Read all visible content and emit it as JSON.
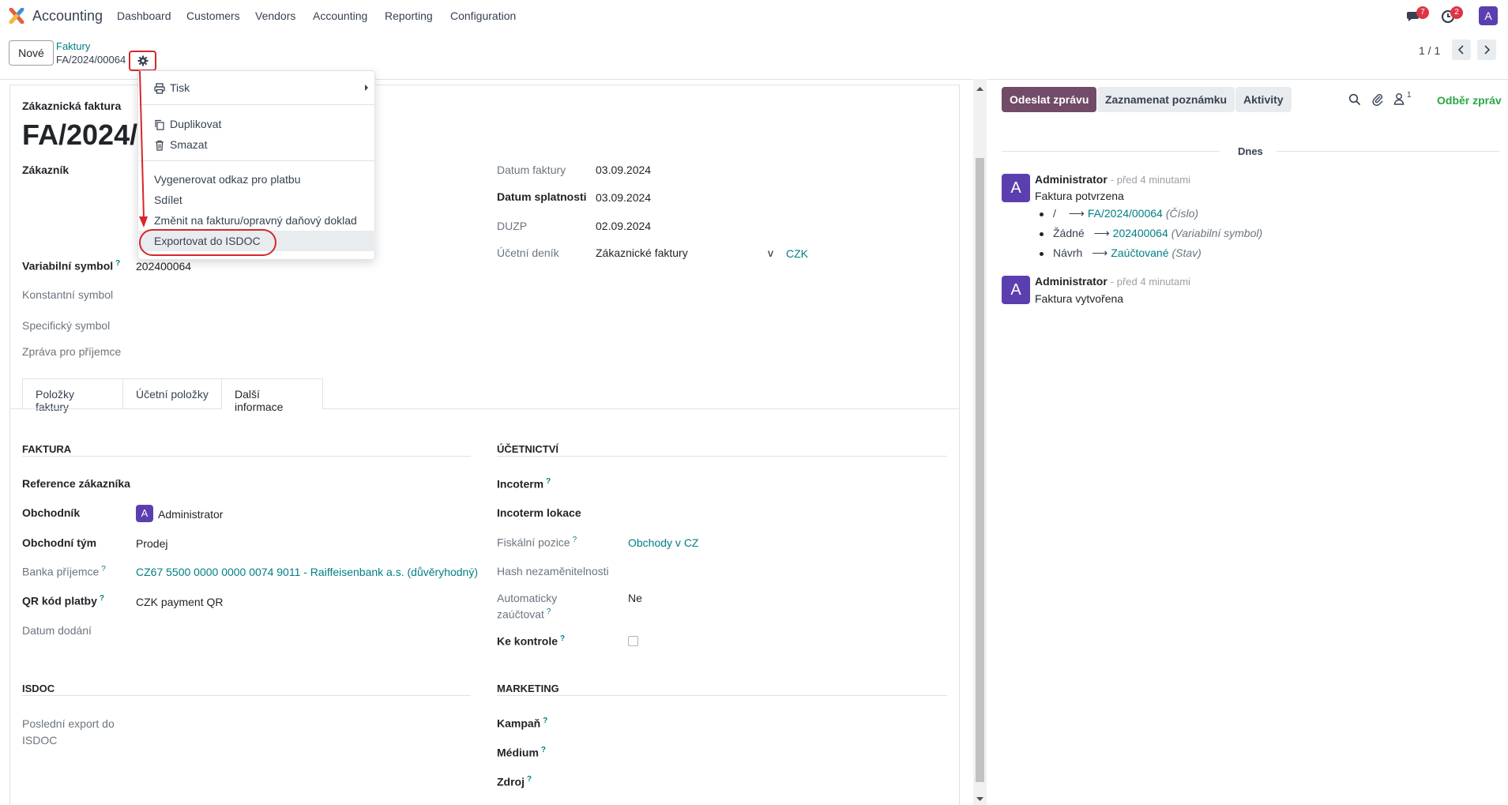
{
  "navbar": {
    "app_name": "Accounting",
    "menu": [
      "Dashboard",
      "Customers",
      "Vendors",
      "Accounting",
      "Reporting",
      "Configuration"
    ],
    "messages_badge": "7",
    "activities_badge": "2",
    "user_initial": "A"
  },
  "control": {
    "new_button": "Nové",
    "breadcrumb_parent": "Faktury",
    "breadcrumb_current": "FA/2024/00064",
    "pager": "1 / 1"
  },
  "dropdown": {
    "print": "Tisk",
    "duplicate": "Duplikovat",
    "delete": "Smazat",
    "gen_payment_link": "Vygenerovat odkaz pro platbu",
    "share": "Sdílet",
    "convert": "Změnit na fakturu/opravný daňový doklad",
    "export_isdoc": "Exportovat do ISDOC"
  },
  "form": {
    "doc_type": "Zákaznická faktura",
    "doc_number": "FA/2024/0",
    "customer_label": "Zákazník",
    "var_symbol_label": "Variabilní symbol",
    "var_symbol_value": "202400064",
    "const_symbol_label": "Konstantní symbol",
    "spec_symbol_label": "Specifický symbol",
    "recipient_msg_label": "Zpráva pro příjemce",
    "invoice_date_label": "Datum faktury",
    "invoice_date_value": "03.09.2024",
    "due_date_label": "Datum splatnosti",
    "due_date_value": "03.09.2024",
    "duzp_label": "DUZP",
    "duzp_value": "02.09.2024",
    "journal_label": "Účetní deník",
    "journal_value": "Zákaznické faktury",
    "journal_in": "v",
    "currency": "CZK"
  },
  "tabs": [
    "Položky faktury",
    "Účetní položky",
    "Další informace"
  ],
  "other_info": {
    "invoice_section": "FAKTURA",
    "customer_ref_label": "Reference zákazníka",
    "salesperson_label": "Obchodník",
    "salesperson_initial": "A",
    "salesperson_value": "Administrator",
    "sales_team_label": "Obchodní tým",
    "sales_team_value": "Prodej",
    "bank_label": "Banka příjemce",
    "bank_value": "CZ67 5500 0000 0000 0074 9011 - Raiffeisenbank a.s. (důvěryhodný)",
    "qr_label": "QR kód platby",
    "qr_value": "CZK payment QR",
    "delivery_date_label": "Datum dodání",
    "accounting_section": "ÚČETNICTVÍ",
    "incoterm_label": "Incoterm",
    "incoterm_location_label": "Incoterm lokace",
    "fiscal_position_label": "Fiskální pozice",
    "fiscal_position_value": "Obchody v CZ",
    "hash_label": "Hash nezaměnitelnosti",
    "auto_post_label_1": "Automaticky",
    "auto_post_label_2": "zaúčtovat",
    "auto_post_value": "Ne",
    "to_check_label": "Ke kontrole",
    "isdoc_section": "ISDOC",
    "last_export_label_1": "Poslední export do",
    "last_export_label_2": "ISDOC",
    "marketing_section": "MARKETING",
    "campaign_label": "Kampaň",
    "medium_label": "Médium",
    "source_label": "Zdroj",
    "help_mark": "?"
  },
  "chatter": {
    "send_message": "Odeslat zprávu",
    "log_note": "Zaznamenat poznámku",
    "activities": "Aktivity",
    "followers_count": "1",
    "follow": "Odběr zpráv",
    "day": "Dnes",
    "messages": [
      {
        "initial": "A",
        "author": "Administrator",
        "time": "- před 4 minutami",
        "body": "Faktura potvrzena",
        "tracking": [
          {
            "old": "/",
            "new": "FA/2024/00064",
            "field": "(Číslo)"
          },
          {
            "old": "Žádné",
            "new": "202400064",
            "field": "(Variabilní symbol)"
          },
          {
            "old": "Návrh",
            "new": "Zaúčtované",
            "field": "(Stav)"
          }
        ]
      },
      {
        "initial": "A",
        "author": "Administrator",
        "time": "- před 4 minutami",
        "body": "Faktura vytvořena"
      }
    ]
  },
  "colors": {
    "brand": "#714b67",
    "link": "#017e84",
    "annotation": "#d6272a"
  }
}
